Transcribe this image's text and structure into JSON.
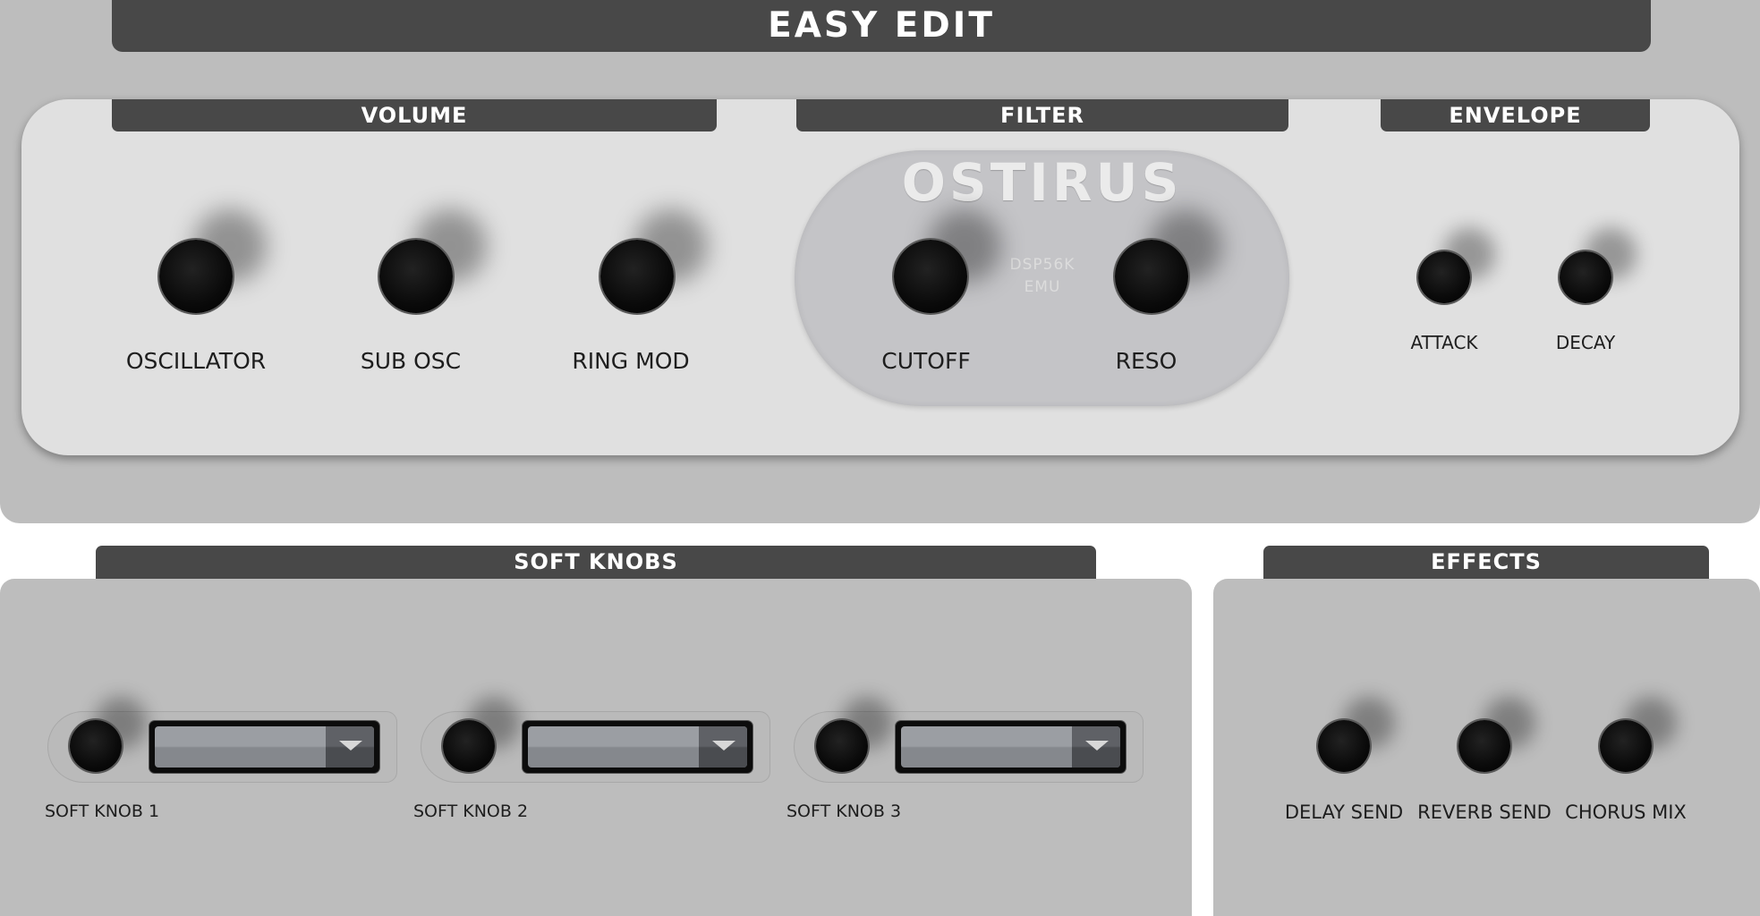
{
  "title": "EASY EDIT",
  "sections": {
    "volume": "VOLUME",
    "filter": "FILTER",
    "envelope": "ENVELOPE",
    "soft_knobs": "SOFT KNOBS",
    "effects": "EFFECTS"
  },
  "brand": {
    "logo": "OSTIRUS",
    "line1": "DSP56K",
    "line2": "EMU"
  },
  "volume_knobs": [
    "OSCILLATOR",
    "SUB OSC",
    "RING MOD"
  ],
  "filter_knobs": [
    "CUTOFF",
    "RESO"
  ],
  "envelope_knobs": [
    "ATTACK",
    "DECAY"
  ],
  "soft_knobs": [
    {
      "label": "SOFT KNOB 1",
      "dropdown_value": ""
    },
    {
      "label": "SOFT KNOB 2",
      "dropdown_value": ""
    },
    {
      "label": "SOFT KNOB 3",
      "dropdown_value": ""
    }
  ],
  "effects_knobs": [
    "DELAY SEND",
    "REVERB SEND",
    "CHORUS MIX"
  ],
  "colors": {
    "panel": "#bdbdbd",
    "inner_panel": "#e0e0e0",
    "header": "#484848",
    "knob": "#000000"
  }
}
